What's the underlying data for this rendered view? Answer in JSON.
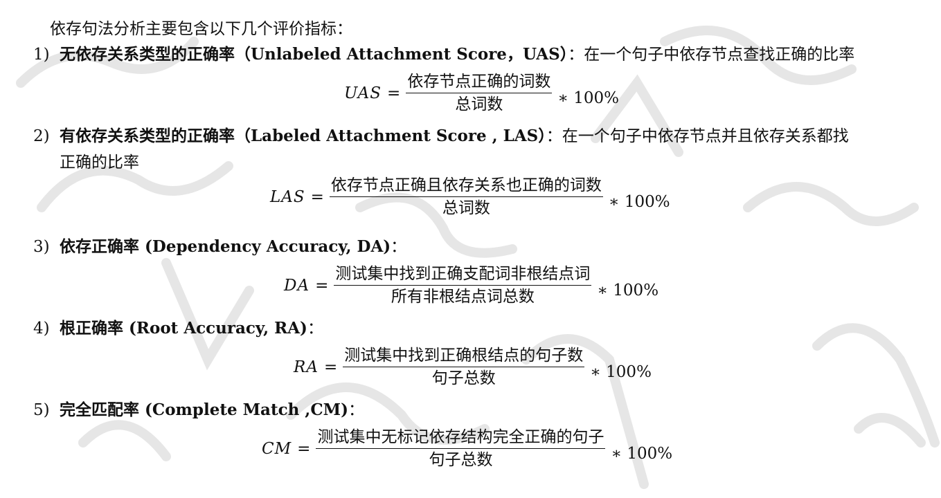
{
  "intro": "依存句法分析主要包含以下几个评价指标：",
  "items": [
    {
      "num": "1)",
      "title": "无依存关系类型的正确率（Unlabeled Attachment Score，UAS）",
      "desc": "：在一个句子中依存节点查找正确的比率",
      "desc2": "",
      "formula": {
        "lhs": "UAS",
        "eq": "=",
        "numerator": "依存节点正确的词数",
        "denominator": "总词数",
        "mul": "∗ 100%"
      }
    },
    {
      "num": "2)",
      "title": "有依存关系类型的正确率（Labeled Attachment Score , LAS）",
      "desc": "：在一个句子中依存节点并且依存关系都找",
      "desc2": "正确的比率",
      "formula": {
        "lhs": "LAS",
        "eq": "=",
        "numerator": "依存节点正确且依存关系也正确的词数",
        "denominator": "总词数",
        "mul": "∗ 100%"
      }
    },
    {
      "num": "3)",
      "title": "依存正确率 (Dependency Accuracy, DA)",
      "desc": "：",
      "desc2": "",
      "formula": {
        "lhs": "DA",
        "eq": "=",
        "numerator": "测试集中找到正确支配词非根结点词",
        "denominator": "所有非根结点词总数",
        "mul": "∗ 100%"
      }
    },
    {
      "num": "4)",
      "title": "根正确率 (Root Accuracy, RA)",
      "desc": "：",
      "desc2": "",
      "formula": {
        "lhs": "RA",
        "eq": "=",
        "numerator": "测试集中找到正确根结点的句子数",
        "denominator": "句子总数",
        "mul": "∗ 100%"
      }
    },
    {
      "num": "5)",
      "title": "完全匹配率 (Complete Match ,CM)",
      "desc": "：",
      "desc2": "",
      "formula": {
        "lhs": "CM",
        "eq": "=",
        "numerator": "测试集中无标记依存结构完全正确的句子",
        "denominator": "句子总数",
        "mul": "∗ 100%"
      }
    }
  ]
}
